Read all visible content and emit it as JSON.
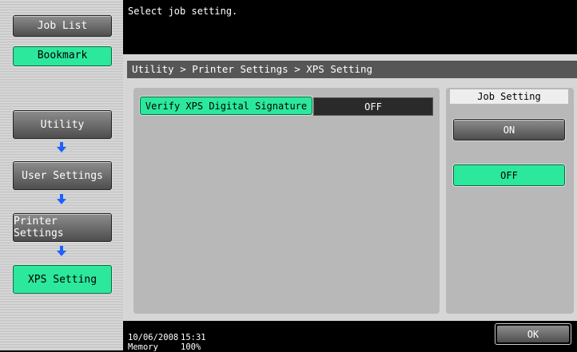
{
  "header": {
    "message": "Select job setting."
  },
  "sidebar": {
    "job_list_label": "Job List",
    "bookmark_label": "Bookmark",
    "path": [
      {
        "label": "Utility"
      },
      {
        "label": "User Settings"
      },
      {
        "label": "Printer Settings"
      },
      {
        "label": "XPS Setting"
      }
    ]
  },
  "breadcrumb": "Utility > Printer Settings > XPS Setting",
  "setting": {
    "label": "Verify XPS Digital Signature",
    "value": "OFF"
  },
  "job_setting": {
    "title": "Job Setting",
    "on_label": "ON",
    "off_label": "OFF",
    "selected": "OFF"
  },
  "footer": {
    "date": "10/06/2008",
    "time": "15:31",
    "memory_label": "Memory",
    "memory_value": "100%",
    "ok_label": "OK"
  },
  "colors": {
    "accent_green": "#2ce89c",
    "button_gray": "#6a6a6a"
  },
  "icons": {
    "path_arrow": "arrow-down-icon"
  }
}
